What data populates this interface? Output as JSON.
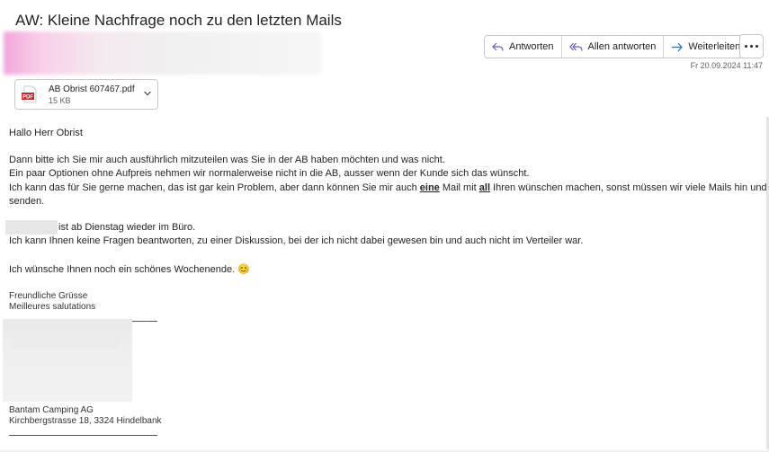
{
  "subject": "AW: Kleine Nachfrage noch zu den letzten Mails",
  "actions": {
    "reply": "Antworten",
    "reply_all": "Allen antworten",
    "forward": "Weiterleiten"
  },
  "date": "Fr 20.09.2024 11:47",
  "attachment": {
    "name": "AB Obrist 607467.pdf",
    "size": "15 KB",
    "icon_text": "PDF"
  },
  "body": {
    "greeting": "Hallo Herr Obrist",
    "p1_line1": "Dann bitte ich Sie mir auch ausführlich mitzuteilen was Sie in der AB haben möchten und was nicht.",
    "p1_line2": "Ein paar Optionen ohne Aufpreis nehmen wir normalerweise nicht in die AB, ausser wenn der Kunde sich das wünscht.",
    "p1_line3_a": "Ich kann das für Sie gerne machen, das ist gar kein Problem, aber dann können Sie mir auch ",
    "p1_line3_b": "eine",
    "p1_line3_c": " Mail mit ",
    "p1_line3_d": "all",
    "p1_line3_e": " Ihren wünschen machen, sonst müssen wir viele Mails hin und her",
    "p1_line4": "senden.",
    "p2_line1": "ist ab Dienstag wieder im Büro.",
    "p2_line2": "Ich kann Ihnen keine Fragen beantworten, zu einer Diskussion, bei der ich nicht dabei gewesen bin und auch nicht im Verteiler war.",
    "p3": "Ich wünsche Ihnen noch ein schönes Wochenende. ",
    "emoji": "😊"
  },
  "signature": {
    "closing1": "Freundliche Grüsse",
    "closing2": "Meilleures salutations",
    "company": "Bantam Camping AG",
    "address": "Kirchbergstrasse 18, 3324 Hindelbank"
  }
}
